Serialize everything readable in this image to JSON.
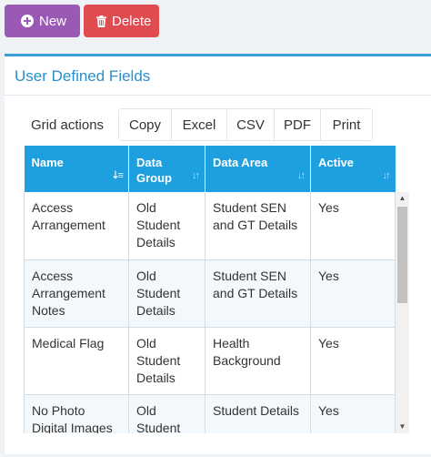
{
  "toolbar": {
    "new_label": "New",
    "delete_label": "Delete"
  },
  "colors": {
    "new": "#9b59b6",
    "delete": "#e04b4f",
    "accent": "#3ba0d8",
    "header": "#1e9fe0"
  },
  "panel": {
    "title": "User Defined Fields"
  },
  "grid_actions": {
    "label": "Grid actions",
    "buttons": [
      "Copy",
      "Excel",
      "CSV",
      "PDF",
      "Print"
    ]
  },
  "table": {
    "columns": [
      "Name",
      "Data Group",
      "Data Area",
      "Active"
    ],
    "rows": [
      [
        "Access Arrangement",
        "Old Student Details",
        "Student SEN and GT Details",
        "Yes"
      ],
      [
        "Access Arrangement Notes",
        "Old Student Details",
        "Student SEN and GT Details",
        "Yes"
      ],
      [
        "Medical Flag",
        "Old Student Details",
        "Health Background",
        "Yes"
      ],
      [
        "No Photo Digital Images",
        "Old Student",
        "Student Details",
        "Yes"
      ]
    ]
  }
}
